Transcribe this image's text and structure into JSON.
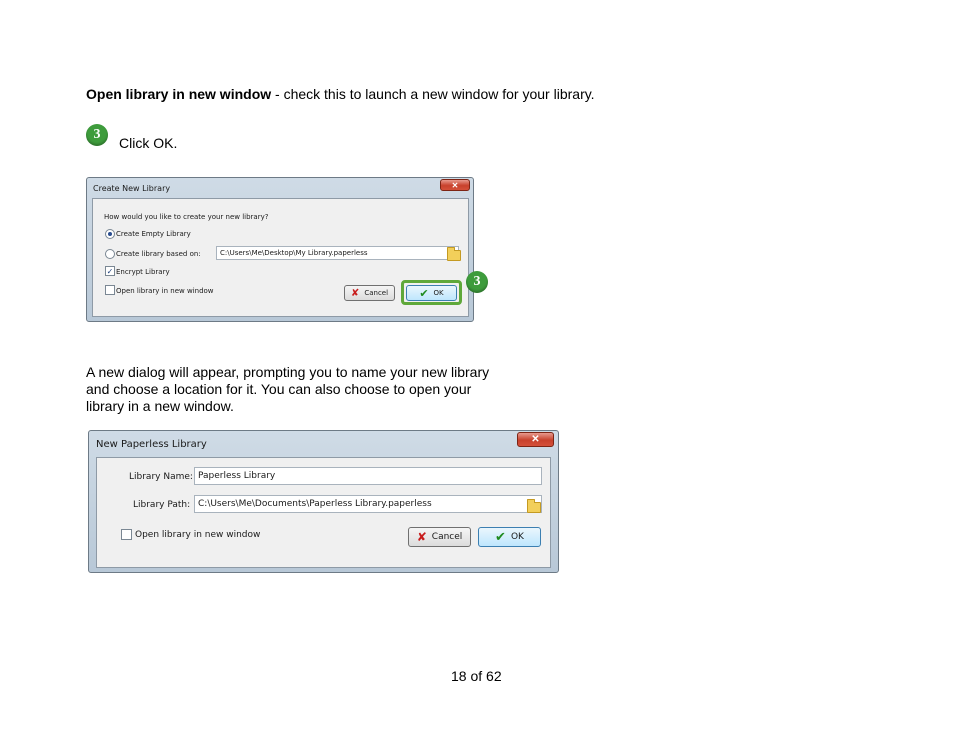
{
  "intro": {
    "bold_term": "Open library in new window",
    "description": " - check this to launch a new window for your library."
  },
  "step": {
    "number": "3",
    "text": "Click OK."
  },
  "dialog1": {
    "title": "Create New Library",
    "close_glyph": "✕",
    "question": "How would you like to create your new library?",
    "option_empty": "Create Empty Library",
    "option_based_on": "Create library based on:",
    "based_on_path": "C:\\Users\\Me\\Desktop\\My Library.paperless",
    "encrypt_label": "Encrypt Library",
    "open_new_window_label": "Open library in new window",
    "cancel_label": "Cancel",
    "ok_label": "OK",
    "callout_number": "3",
    "callout_color": "#3e9c3c"
  },
  "paragraph2": "A new dialog will appear, prompting you to name your new library and choose a location for it. You can also choose to open your library in a new window.",
  "dialog2": {
    "title": "New Paperless Library",
    "close_glyph": "✕",
    "name_label": "Library Name:",
    "name_value": "Paperless Library",
    "path_label": "Library Path:",
    "path_value": "C:\\Users\\Me\\Documents\\Paperless Library.paperless",
    "open_new_window_label": "Open library in new window",
    "cancel_label": "Cancel",
    "ok_label": "OK"
  },
  "footer": {
    "page_label": "18 of 62"
  }
}
